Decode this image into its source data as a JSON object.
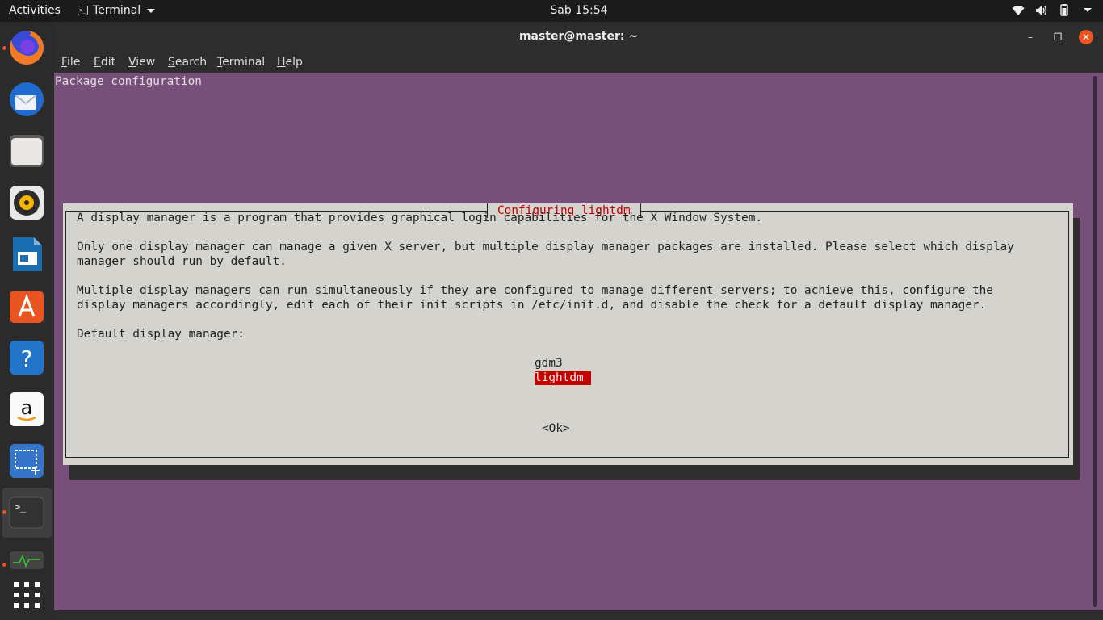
{
  "topbar": {
    "activities": "Activities",
    "app_name": "Terminal",
    "clock": "Sab 15:54"
  },
  "dock": {
    "items": [
      "Firefox",
      "Thunderbird",
      "Files",
      "Rhythmbox",
      "LibreOffice Impress",
      "Ubuntu Software",
      "Help",
      "Amazon",
      "Screenshot",
      "Terminal",
      "System Monitor",
      "Show Applications"
    ]
  },
  "window": {
    "title": "master@master: ~",
    "menu": [
      "File",
      "Edit",
      "View",
      "Search",
      "Terminal",
      "Help"
    ]
  },
  "terminal": {
    "header": "Package configuration"
  },
  "dialog": {
    "title": "Configuring lightdm",
    "lines": [
      "A display manager is a program that provides graphical login capabilities for the X Window System.",
      "Only one display manager can manage a given X server, but multiple display manager packages are installed. Please select which display",
      "manager should run by default.",
      "Multiple display managers can run simultaneously if they are configured to manage different servers; to achieve this, configure the",
      "display managers accordingly, edit each of their init scripts in /etc/init.d, and disable the check for a default display manager.",
      "Default display manager:"
    ],
    "options": [
      "gdm3",
      "lightdm"
    ],
    "selected_option": "lightdm",
    "ok_button": "<Ok>"
  },
  "colors": {
    "terminal_bg": "#77507a",
    "dialog_bg": "#d4d3ce",
    "accent_red": "#c40000",
    "ubuntu_orange": "#e95420"
  }
}
